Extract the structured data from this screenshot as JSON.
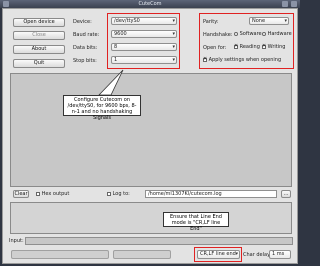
{
  "window": {
    "title": "CuteCom"
  },
  "buttons": {
    "open_device": "Open device",
    "close": "Close",
    "about": "About",
    "quit": "Quit",
    "clear": "Clear",
    "dotdotdot": "..."
  },
  "settings": {
    "device_label": "Device:",
    "device_value": "/dev/ttyS0",
    "baud_label": "Baud rate:",
    "baud_value": "9600",
    "databits_label": "Data bits:",
    "databits_value": "8",
    "stopbits_label": "Stop bits:",
    "stopbits_value": "1",
    "parity_label": "Parity:",
    "parity_value": "None",
    "handshake_label": "Handshake:",
    "handshake_software": "Software",
    "handshake_hardware": "Hardware",
    "openfor_label": "Open for:",
    "openfor_reading": "Reading",
    "openfor_writing": "Writing",
    "apply_label": "Apply settings when opening"
  },
  "output": {
    "hex_output_label": "Hex output",
    "log_to_label": "Log to:",
    "log_path": "/home/ml1307Kl/cutecom.log"
  },
  "input": {
    "input_label": "Input:",
    "line_end_value": "CR,LF line end",
    "char_delay_label": "Char delay:",
    "char_delay_value": "1 ms"
  },
  "annotations": {
    "callout1": "Configure Cutecom on /dev/ttyS0, for 9600 bps, 8-n-1 and no handshaking Signals",
    "callout2": "Ensure that Line End mode is \"CR,LF line End\""
  },
  "colors": {
    "annotation_red": "#e02222"
  }
}
